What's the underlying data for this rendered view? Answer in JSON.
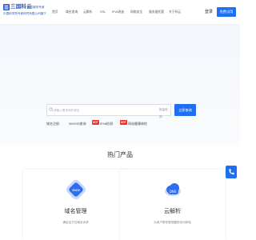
{
  "header": {
    "logo": {
      "name": "三国科云",
      "slogan": "域名服务专家",
      "company": "中国科学院专家研究有限公司旗下"
    },
    "nav": [
      "首页",
      "域名查询",
      "云解析",
      "SSL",
      "IPv6改造",
      "网络安全",
      "服务器托管",
      "关于科云"
    ],
    "login_label": "登录",
    "register_label": "免费试用"
  },
  "search": {
    "placeholder": "请输入要查询的域名",
    "suffix": "批量查询",
    "button_label": "立即查询"
  },
  "quick_links": [
    {
      "label": "域名注册",
      "tag": ""
    },
    {
      "label": "WHOIS查询",
      "tag": ""
    },
    {
      "label": "IPv6检测",
      "tag": "HOT"
    },
    {
      "label": "网站健康体检",
      "tag": "HOT"
    }
  ],
  "section": {
    "title": "热门产品",
    "cards": [
      {
        "title": "域名管理",
        "desc": "满足全方位域名诉求",
        "icon": "domain-management-icon"
      },
      {
        "title": "云解析",
        "desc": "为用户带来更快捷的访问体验",
        "icon": "cloud-dns-icon"
      }
    ]
  },
  "colors": {
    "accent": "#1f6ff2",
    "hot": "#e5322d",
    "brand": "#2a59c6"
  }
}
